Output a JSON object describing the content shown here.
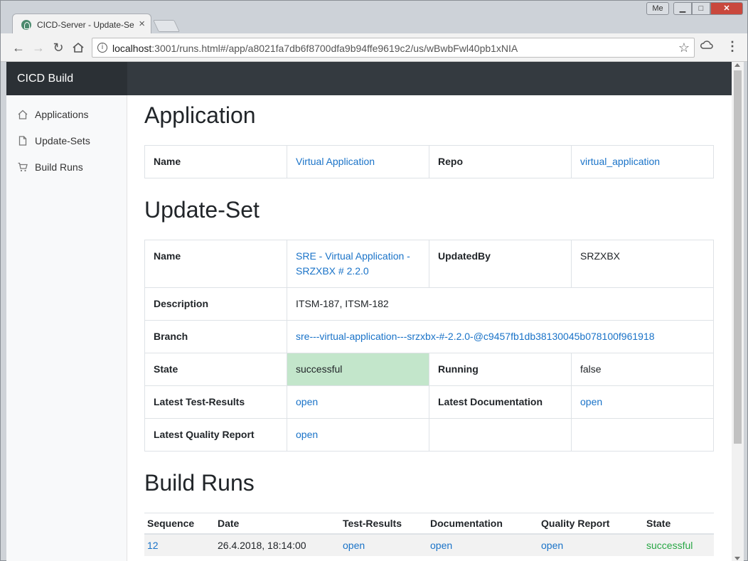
{
  "browser": {
    "tab_title": "CICD-Server - Update-Se",
    "tab_close": "×",
    "url_host": "localhost",
    "url_rest": ":3001/runs.html#/app/a8021fa7db6f8700dfa9b94ffe9619c2/us/wBwbFwl40pb1xNIA",
    "profile_label": "Me",
    "window_minimize": "▁",
    "window_maximize": "□",
    "window_close": "✕"
  },
  "navbar": {
    "brand": "CICD Build"
  },
  "sidebar": {
    "items": [
      {
        "label": "Applications",
        "icon": "home-icon"
      },
      {
        "label": "Update-Sets",
        "icon": "file-icon"
      },
      {
        "label": "Build Runs",
        "icon": "cart-icon"
      }
    ]
  },
  "application": {
    "heading": "Application",
    "name_label": "Name",
    "name_value": "Virtual Application",
    "repo_label": "Repo",
    "repo_value": "virtual_application"
  },
  "update_set": {
    "heading": "Update-Set",
    "name_label": "Name",
    "name_value": "SRE - Virtual Application - SRZXBX # 2.2.0",
    "updated_by_label": "UpdatedBy",
    "updated_by_value": "SRZXBX",
    "description_label": "Description",
    "description_value": "ITSM-187, ITSM-182",
    "branch_label": "Branch",
    "branch_value": "sre---virtual-application---srzxbx-#-2.2.0-@c9457fb1db38130045b078100f961918",
    "state_label": "State",
    "state_value": "successful",
    "state_color": "#c3e6cb",
    "running_label": "Running",
    "running_value": "false",
    "test_results_label": "Latest Test-Results",
    "test_results_value": "open",
    "documentation_label": "Latest Documentation",
    "documentation_value": "open",
    "quality_label": "Latest Quality Report",
    "quality_value": "open"
  },
  "build_runs": {
    "heading": "Build Runs",
    "columns": [
      "Sequence",
      "Date",
      "Test-Results",
      "Documentation",
      "Quality Report",
      "State"
    ],
    "rows": [
      {
        "sequence": "12",
        "date": "26.4.2018, 18:14:00",
        "test_results": "open",
        "documentation": "open",
        "quality": "open",
        "state": "successful"
      }
    ]
  },
  "colors": {
    "navbar": "#343a40",
    "link": "#1a73c8",
    "success": "#28a745"
  }
}
